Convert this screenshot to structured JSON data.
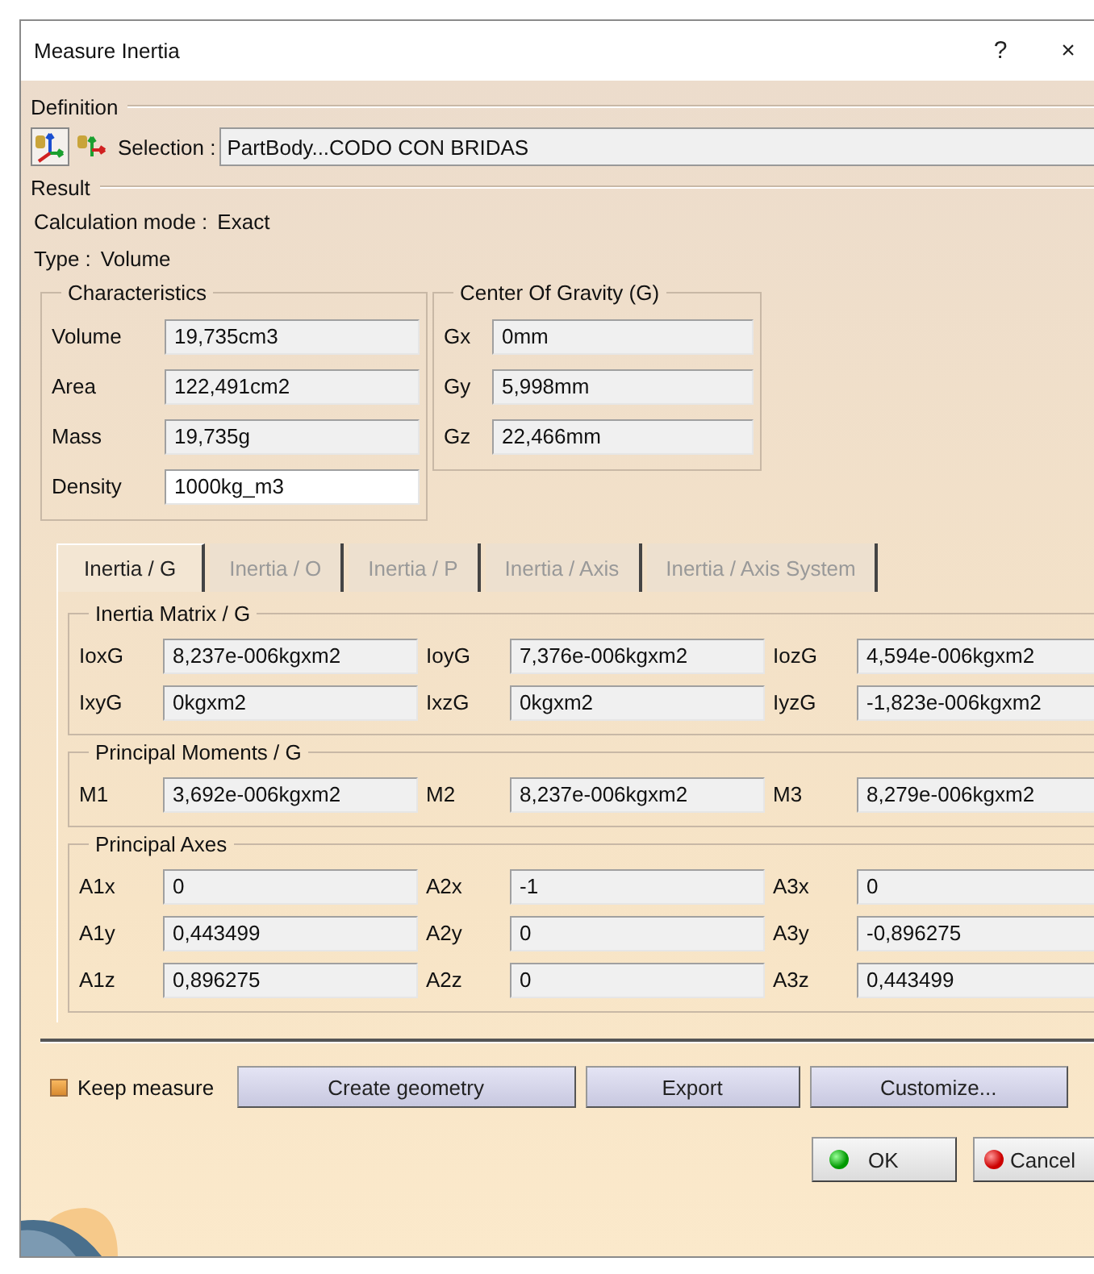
{
  "window": {
    "title": "Measure Inertia",
    "help_button": "?",
    "close_button": "×"
  },
  "definition": {
    "label": "Definition",
    "mode_buttons": [
      {
        "selected": true
      },
      {
        "selected": false
      }
    ],
    "selection_label": "Selection :",
    "selection": "PartBody...CODO CON BRIDAS"
  },
  "result": {
    "label": "Result",
    "calculation_mode": {
      "label": "Calculation mode :",
      "value": "Exact"
    },
    "type": {
      "label": "Type :",
      "value": "Volume"
    }
  },
  "characteristics": {
    "title": "Characteristics",
    "rows": [
      {
        "label": "Volume",
        "value": "19,735cm3",
        "editable": false
      },
      {
        "label": "Area",
        "value": "122,491cm2",
        "editable": false
      },
      {
        "label": "Mass",
        "value": "19,735g",
        "editable": false
      },
      {
        "label": "Density",
        "value": "1000kg_m3",
        "editable": true
      }
    ]
  },
  "center_of_gravity": {
    "title": "Center Of Gravity (G)",
    "rows": [
      {
        "label": "Gx",
        "value": "0mm"
      },
      {
        "label": "Gy",
        "value": "5,998mm"
      },
      {
        "label": "Gz",
        "value": "22,466mm"
      }
    ]
  },
  "tabs": [
    {
      "label": "Inertia / G",
      "selected": true
    },
    {
      "label": "Inertia / O",
      "selected": false
    },
    {
      "label": "Inertia / P",
      "selected": false
    },
    {
      "label": "Inertia / Axis",
      "selected": false
    },
    {
      "label": "Inertia / Axis System",
      "selected": false
    }
  ],
  "inertia_matrix": {
    "title": "Inertia Matrix / G",
    "fields": [
      {
        "label": "IoxG",
        "value": "8,237e-006kgxm2"
      },
      {
        "label": "IoyG",
        "value": "7,376e-006kgxm2"
      },
      {
        "label": "IozG",
        "value": "4,594e-006kgxm2"
      },
      {
        "label": "IxyG",
        "value": "0kgxm2"
      },
      {
        "label": "IxzG",
        "value": "0kgxm2"
      },
      {
        "label": "IyzG",
        "value": "-1,823e-006kgxm2"
      }
    ]
  },
  "principal_moments": {
    "title": "Principal Moments / G",
    "fields": [
      {
        "label": "M1",
        "value": "3,692e-006kgxm2"
      },
      {
        "label": "M2",
        "value": "8,237e-006kgxm2"
      },
      {
        "label": "M3",
        "value": "8,279e-006kgxm2"
      }
    ]
  },
  "principal_axes": {
    "title": "Principal Axes",
    "fields": [
      {
        "label": "A1x",
        "value": "0"
      },
      {
        "label": "A2x",
        "value": "-1"
      },
      {
        "label": "A3x",
        "value": "0"
      },
      {
        "label": "A1y",
        "value": "0,443499"
      },
      {
        "label": "A2y",
        "value": "0"
      },
      {
        "label": "A3y",
        "value": "-0,896275"
      },
      {
        "label": "A1z",
        "value": "0,896275"
      },
      {
        "label": "A2z",
        "value": "0"
      },
      {
        "label": "A3z",
        "value": "0,443499"
      }
    ]
  },
  "keep_measure": {
    "label": "Keep measure",
    "checked": true
  },
  "buttons": [
    "Create geometry",
    "Export",
    "Customize..."
  ],
  "dialog_buttons": [
    {
      "label": "OK",
      "kind": "ok"
    },
    {
      "label": "Cancel",
      "kind": "cancel"
    }
  ]
}
